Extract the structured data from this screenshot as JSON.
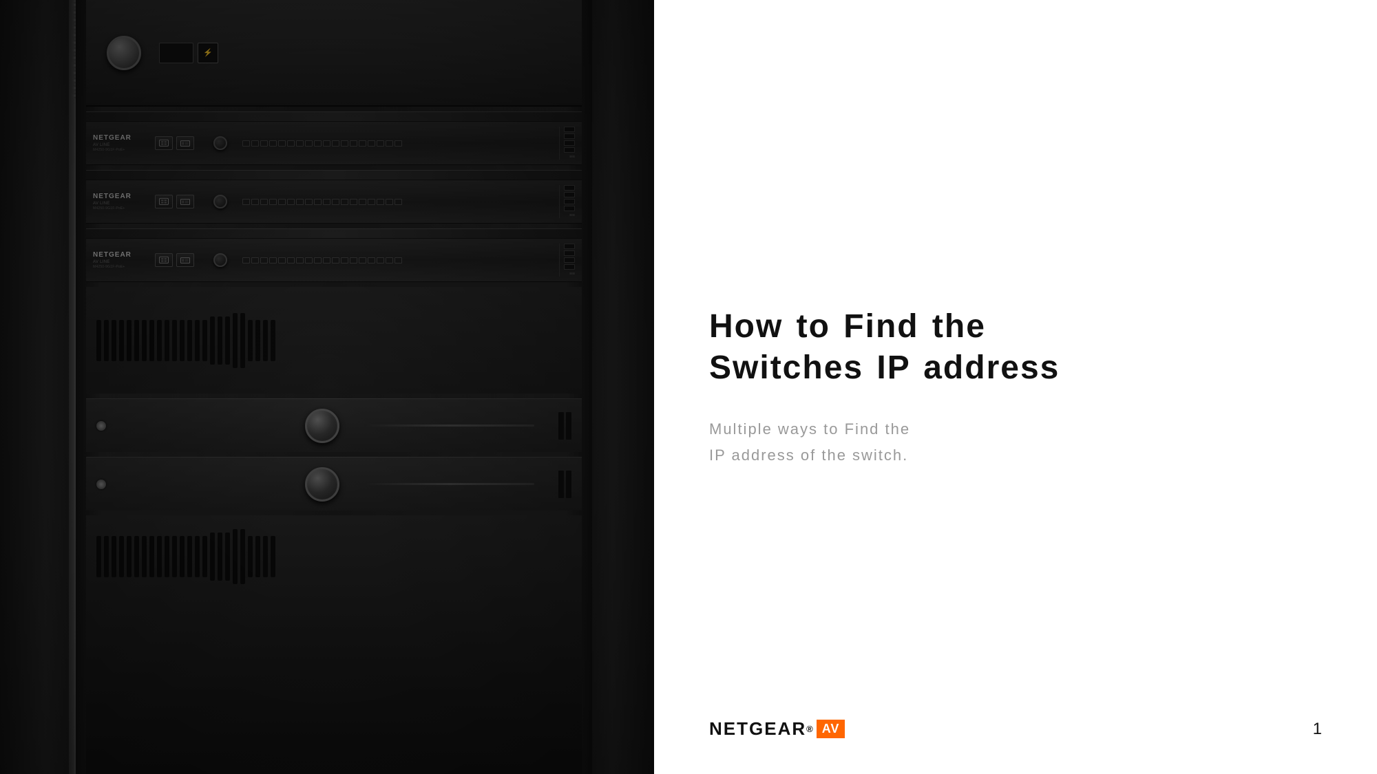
{
  "left": {
    "description": "Network rack with NETGEAR switches"
  },
  "right": {
    "title": {
      "line1": "How to Find the",
      "line2": "Switches IP address"
    },
    "subtitle": {
      "line1": "Multiple ways to Find the",
      "line2": "IP address of the switch."
    }
  },
  "footer": {
    "logo_netgear": "NETGEAR",
    "logo_registered": "®",
    "logo_av": "AV",
    "page_number": "1"
  },
  "switches": [
    {
      "brand": "NETGEAR",
      "sub": "AV LINE"
    },
    {
      "brand": "NETGEAR",
      "sub": "AV LINE"
    },
    {
      "brand": "NETGEAR",
      "sub": "AV LINE"
    }
  ]
}
